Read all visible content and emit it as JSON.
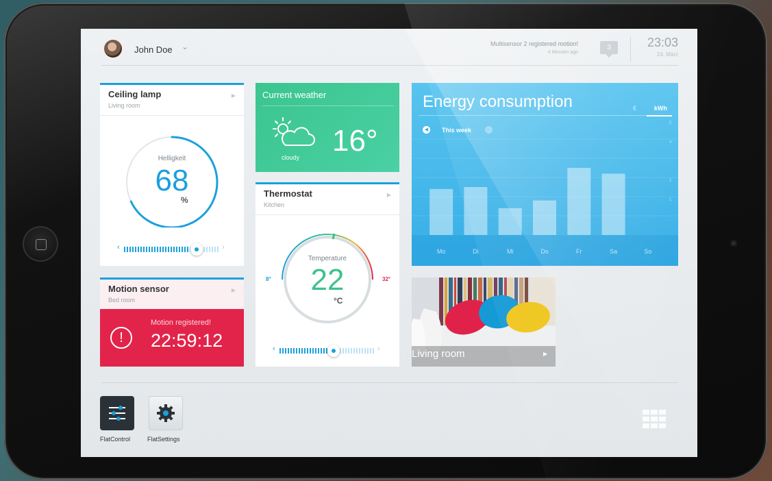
{
  "header": {
    "user_name": "John Doe",
    "notification_text": "Multisensor 2 registered motion!",
    "notification_time": "4 Minuten ago",
    "notification_count": "3",
    "clock": "23:03",
    "date": "24. März"
  },
  "ceiling_lamp": {
    "title": "Ceiling lamp",
    "room": "Living room",
    "dial_label": "Helligkeit",
    "value": "68",
    "unit": "%",
    "level": 0.68
  },
  "weather": {
    "title": "Current weather",
    "temperature": "16°",
    "condition": "cloudy"
  },
  "thermostat": {
    "title": "Thermostat",
    "room": "Kitchen",
    "dial_label": "Temperature",
    "value": "22",
    "unit": "°C",
    "min_label": "8°",
    "max_label": "32°"
  },
  "motion_sensor": {
    "title": "Motion sensor",
    "room": "Bed room",
    "alert_text": "Motion registered!",
    "alert_time": "22:59:12"
  },
  "energy": {
    "title": "Energy consumption",
    "unit_euro": "€",
    "unit_kwh": "kWh",
    "period": "This week"
  },
  "chart_data": {
    "type": "bar",
    "categories": [
      "Mo",
      "Di",
      "Mi",
      "Do",
      "Fr",
      "Sa",
      "So"
    ],
    "values": [
      2.4,
      2.5,
      1.4,
      1.8,
      3.5,
      3.2,
      0
    ],
    "yticks": [
      "5",
      "4",
      "2",
      "1"
    ],
    "ylim": [
      0,
      5
    ]
  },
  "living_room": {
    "title": "Living room"
  },
  "dock": {
    "apps": [
      {
        "label": "FlatControl"
      },
      {
        "label": "FlatSettings"
      }
    ]
  },
  "colors": {
    "accent": "#1aa0dc",
    "weather": "#3bc58f",
    "alert": "#e2244a",
    "energy": "#45b9ec"
  }
}
